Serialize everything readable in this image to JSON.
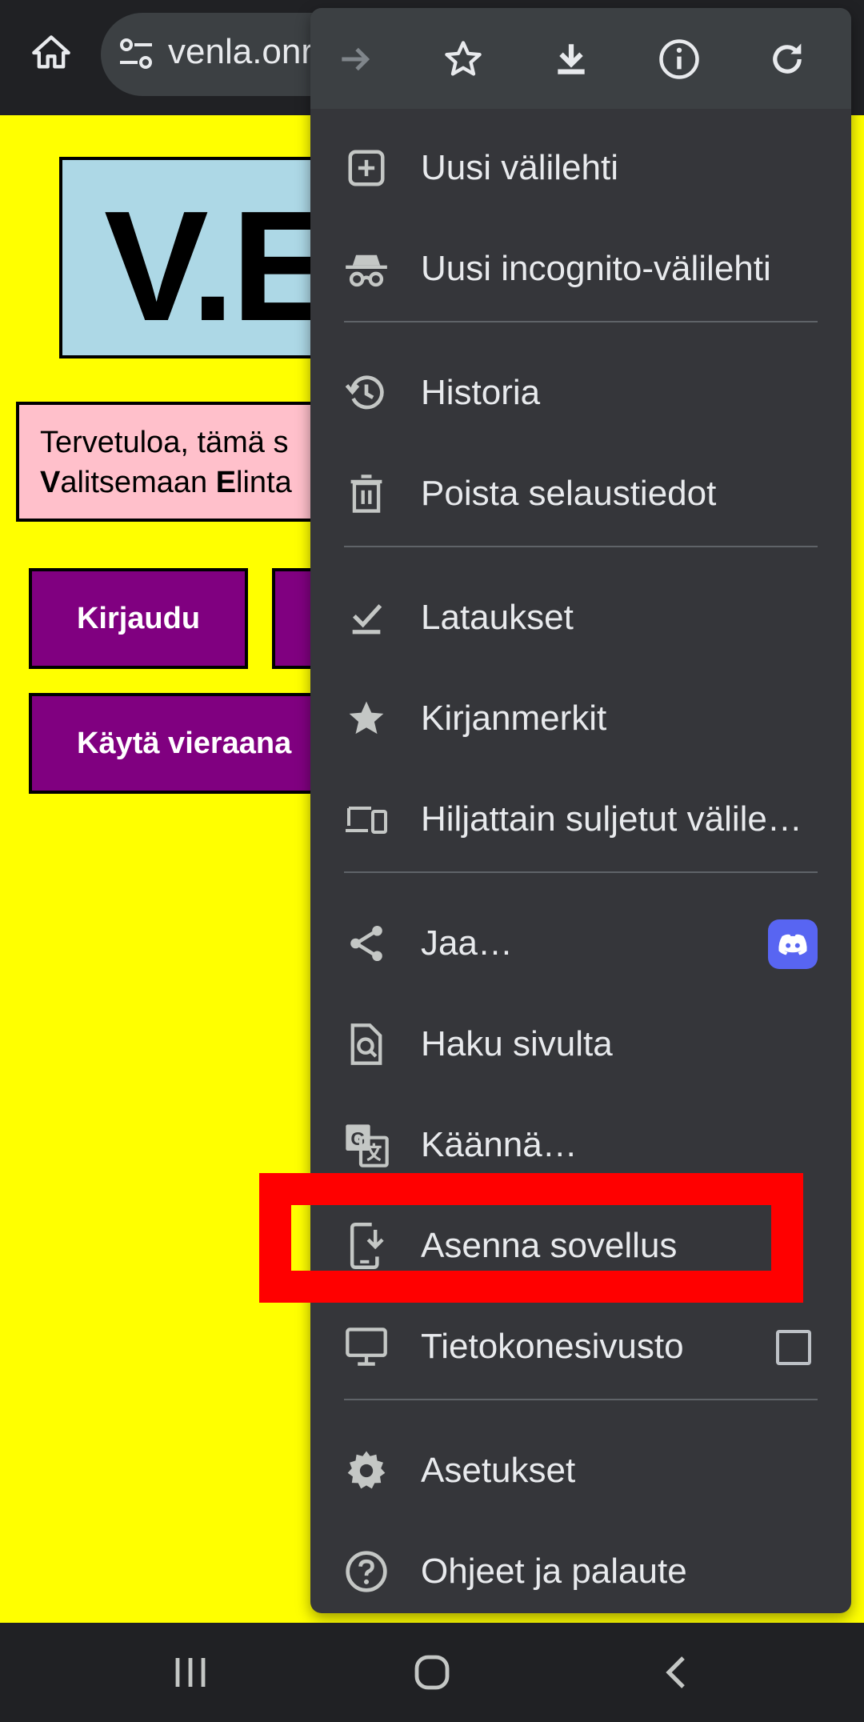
{
  "browser": {
    "url": "venla.onr",
    "home_icon": "home-icon",
    "site_settings_icon": "tune-icon"
  },
  "page": {
    "title_fragment": "V.E",
    "welcome_line1": "Tervetuloa, tämä s",
    "welcome_line2_bold1": "V",
    "welcome_line2_mid": "alitsemaan ",
    "welcome_line2_bold2": "E",
    "welcome_line2_end": "linta",
    "login_label": "Kirjaudu",
    "guest_label": "Käytä vieraana",
    "colors": {
      "background": "#ffff00",
      "title_box": "#add8e6",
      "welcome_box": "#ffc0cb",
      "button": "#800080"
    }
  },
  "menu": {
    "toolbar": [
      "forward-icon",
      "bookmark-star-icon",
      "download-icon",
      "info-icon",
      "reload-icon"
    ],
    "items": [
      {
        "label": "Uusi välilehti",
        "icon": "new-tab-icon"
      },
      {
        "label": "Uusi incognito-välilehti",
        "icon": "incognito-icon"
      },
      {
        "label": "Historia",
        "icon": "history-icon"
      },
      {
        "label": "Poista selaustiedot",
        "icon": "trash-icon"
      },
      {
        "label": "Lataukset",
        "icon": "downloads-check-icon"
      },
      {
        "label": "Kirjanmerkit",
        "icon": "star-icon"
      },
      {
        "label": "Hiljattain suljetut välile…",
        "icon": "devices-icon"
      },
      {
        "label": "Jaa…",
        "icon": "share-icon"
      },
      {
        "label": "Haku sivulta",
        "icon": "find-in-page-icon"
      },
      {
        "label": "Käännä…",
        "icon": "translate-icon"
      },
      {
        "label": "Asenna sovellus",
        "icon": "install-app-icon"
      },
      {
        "label": "Tietokonesivusto",
        "icon": "desktop-icon"
      },
      {
        "label": "Asetukset",
        "icon": "gear-icon"
      },
      {
        "label": "Ohjeet ja palaute",
        "icon": "help-icon"
      }
    ],
    "desktop_site_checked": false,
    "highlight_color": "#ff0000"
  },
  "navbar": [
    "recent-apps-icon",
    "home-nav-icon",
    "back-icon"
  ]
}
